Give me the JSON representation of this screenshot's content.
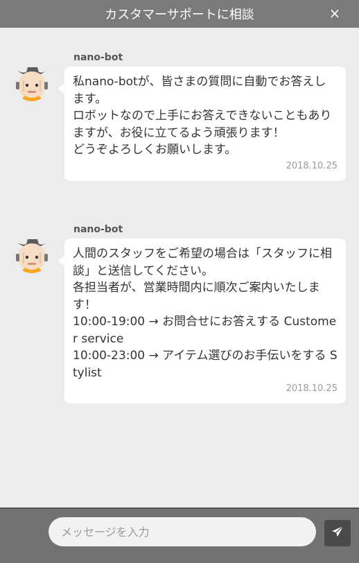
{
  "header": {
    "title": "カスタマーサポートに相談",
    "close_icon": "×"
  },
  "messages": [
    {
      "sender": "nano-bot",
      "text": "私nano-botが、皆さまの質問に自動でお答えします。\nロボットなので上手にお答えできないこともありますが、お役に立てるよう頑張ります！\nどうぞよろしくお願いします。",
      "timestamp": "2018.10.25"
    },
    {
      "sender": "nano-bot",
      "text": "人間のスタッフをご希望の場合は「スタッフに相談」と送信してください。\n各担当者が、営業時間内に順次ご案内いたします！\n10:00-19:00 → お問合せにお答えする Customer service\n10:00-23:00 → アイテム選びのお手伝いをする Stylist",
      "timestamp": "2018.10.25"
    }
  ],
  "composer": {
    "placeholder": "メッセージを入力",
    "value": "",
    "send_icon": "paper-plane-icon"
  },
  "colors": {
    "header_bg": "#7a7a7a",
    "chat_bg": "#ececec",
    "footer_bg": "#727272",
    "send_bg": "#4a4a4a",
    "avatar_accent": "#f5a623"
  }
}
